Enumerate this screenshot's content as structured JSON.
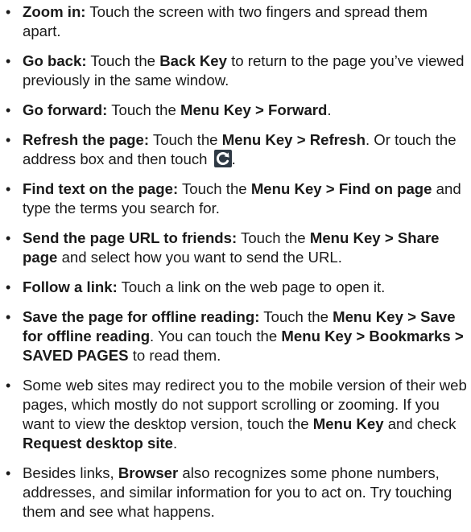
{
  "items": [
    {
      "lead": "Zoom in:",
      "text": " Touch the screen with two fingers and spread them apart."
    },
    {
      "lead": "Go back:",
      "t1": " Touch the ",
      "b1": "Back Key",
      "t2": " to return to the page you’ve viewed previously in the same window."
    },
    {
      "lead": "Go forward:",
      "t1": " Touch the ",
      "b1": "Menu Key > Forward",
      "t2": "."
    },
    {
      "lead": "Refresh the page:",
      "t1": " Touch the ",
      "b1": "Menu Key > Refresh",
      "t2": ". Or touch the address box and then touch ",
      "icon": "refresh-icon",
      "t3": "."
    },
    {
      "lead": "Find text on the page:",
      "t1": " Touch the ",
      "b1": "Menu Key > Find on page",
      "t2": " and type the terms you search for."
    },
    {
      "lead": "Send the page URL to friends:",
      "t1": " Touch the ",
      "b1": "Menu Key > Share page",
      "t2": " and select how you want to send the URL."
    },
    {
      "lead": "Follow a link:",
      "text": " Touch a link on the web page to open it."
    },
    {
      "lead": "Save the page for offline reading:",
      "t1": " Touch the ",
      "b1": "Menu Key > Save for offline reading",
      "t2": ". You can touch the ",
      "b2": "Menu Key > Bookmarks > SAVED PAGES",
      "t3": " to read them."
    },
    {
      "t1": "Some web sites may redirect you to the mobile version of their web pages, which mostly do not support scrolling or zooming. If you want to view the desktop version, touch the ",
      "b1": "Menu Key",
      "t2": " and check ",
      "b2": "Request desktop site",
      "t3": "."
    },
    {
      "t1": "Besides links, ",
      "b1": "Browser",
      "t2": " also recognizes some phone numbers, addresses, and similar information for you to act on. Try touching them and see what happens."
    }
  ],
  "bullet_char": "•",
  "colors": {
    "text": "#1a1a1a",
    "icon_bg": "#2f3a45",
    "icon_ring": "#ffffff"
  }
}
